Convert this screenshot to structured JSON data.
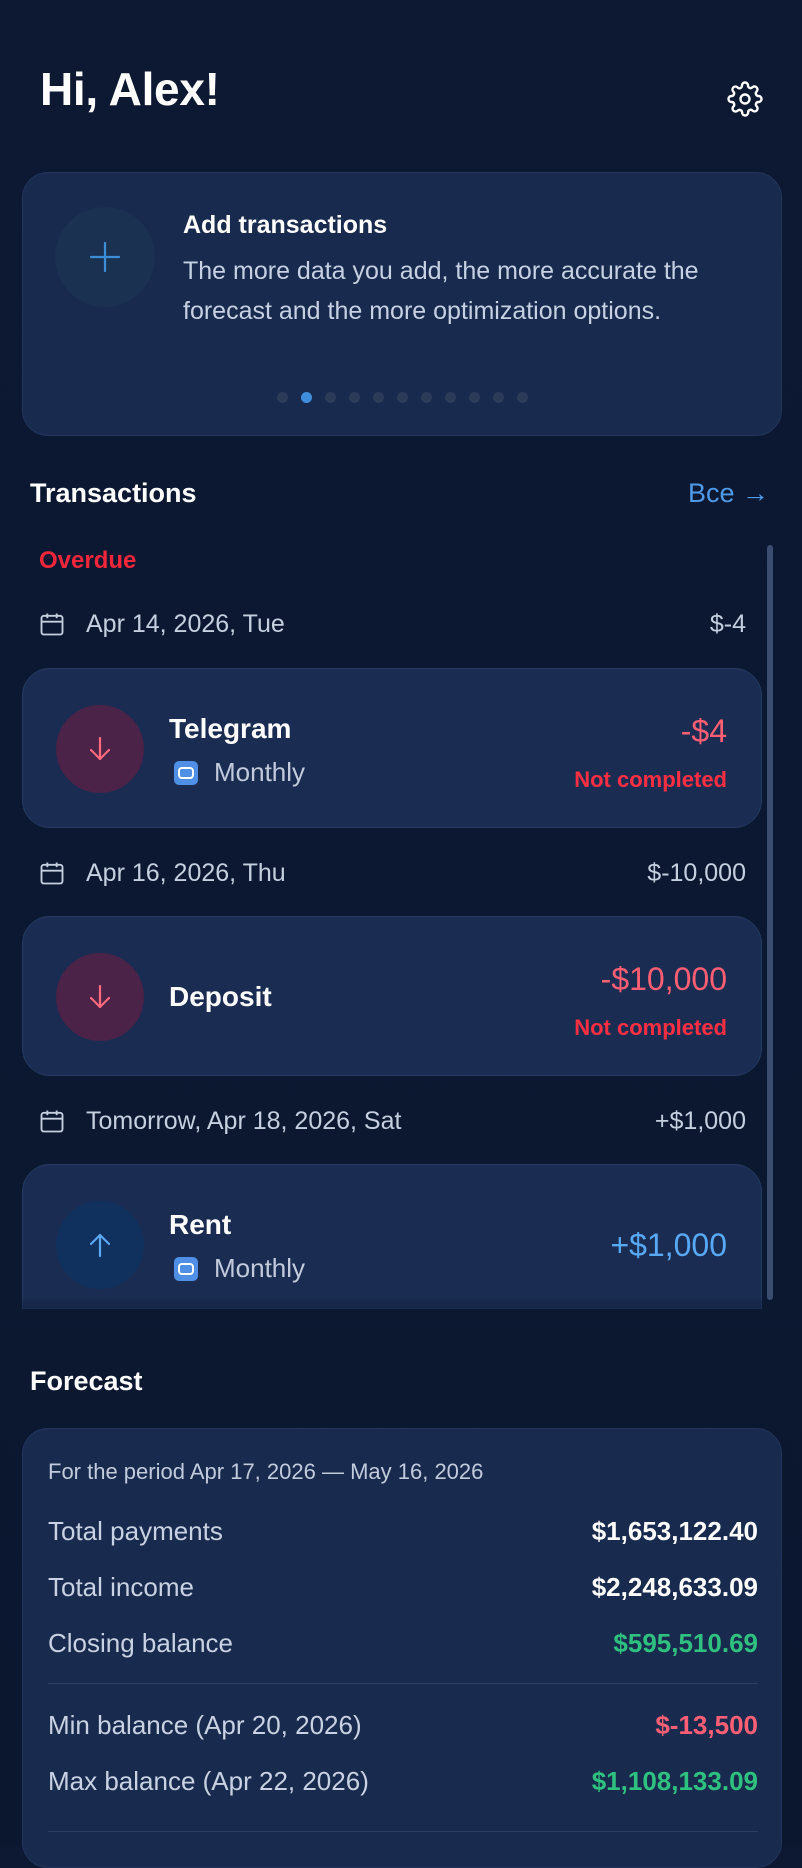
{
  "header": {
    "greeting": "Hi, Alex!",
    "settings_icon": "gear-icon"
  },
  "promo": {
    "icon": "plus-icon",
    "title": "Add transactions",
    "text": "The more data you add, the more accurate the forecast and the more optimization options.",
    "pages": 11,
    "active_page": 2
  },
  "transactions": {
    "title": "Transactions",
    "see_all": "Все →",
    "overdue_label": "Overdue",
    "groups": [
      {
        "date": "Apr 14, 2026, Tue",
        "sum": "$-4",
        "items": [
          {
            "name": "Telegram",
            "recurrence": "Monthly",
            "amount": "-$4",
            "status": "Not completed",
            "direction": "out"
          }
        ]
      },
      {
        "date": "Apr 16, 2026, Thu",
        "sum": "$-10,000",
        "items": [
          {
            "name": "Deposit",
            "recurrence": "",
            "amount": "-$10,000",
            "status": "Not completed",
            "direction": "out"
          }
        ]
      },
      {
        "date": "Tomorrow, Apr 18, 2026, Sat",
        "sum": "+$1,000",
        "items": [
          {
            "name": "Rent",
            "recurrence": "Monthly",
            "amount": "+$1,000",
            "status": "",
            "direction": "in"
          }
        ]
      }
    ]
  },
  "forecast": {
    "title": "Forecast",
    "period": "For the period Apr 17, 2026 — May 16, 2026",
    "total_payments_label": "Total payments",
    "total_payments": "$1,653,122.40",
    "total_income_label": "Total income",
    "total_income": "$2,248,633.09",
    "closing_balance_label": "Closing balance",
    "closing_balance": "$595,510.69",
    "min_balance_label": "Min balance (Apr 20, 2026)",
    "min_balance": "$-13,500",
    "max_balance_label": "Max balance (Apr 22, 2026)",
    "max_balance": "$1,108,133.09"
  },
  "colors": {
    "background": "#0c1831",
    "card": "#1b2c52",
    "accent": "#4f9ae8",
    "negative": "#ff5e73",
    "overdue": "#f0263a",
    "positive": "#2fc17f"
  }
}
